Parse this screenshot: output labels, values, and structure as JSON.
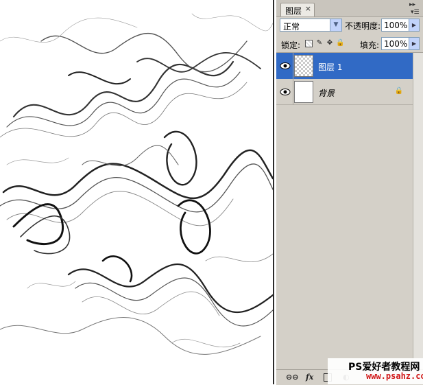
{
  "panel": {
    "tab_label": "图层",
    "tab_close": "×",
    "blend_mode": "正常",
    "opacity_label": "不透明度:",
    "opacity_value": "100%",
    "lock_label": "锁定:",
    "fill_label": "填充:",
    "fill_value": "100%",
    "layers": [
      {
        "name": "图层 1",
        "selected": true,
        "visible": true,
        "thumbnail": "transparent-checker"
      },
      {
        "name": "背景",
        "selected": false,
        "visible": true,
        "locked": true,
        "thumbnail": "white"
      }
    ],
    "bottom_icons": [
      "link-icon",
      "fx-icon",
      "mask-icon",
      "adjustment-icon",
      "group-icon",
      "new-layer-icon",
      "trash-icon"
    ],
    "fx_label": "fx"
  },
  "watermark": {
    "line1": "PS爱好者教程网",
    "line2": "www.psahz.com"
  },
  "colors": {
    "selection": "#316ac5",
    "panel_bg": "#d4d0c8",
    "watermark_url": "#d01818"
  }
}
